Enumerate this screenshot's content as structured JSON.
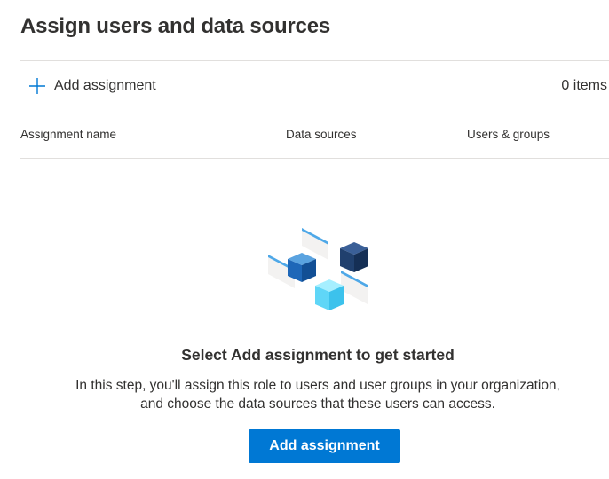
{
  "header": {
    "title": "Assign users and data sources"
  },
  "command_bar": {
    "add_label": "Add assignment",
    "add_icon": "plus-icon",
    "item_count": "0 items"
  },
  "table": {
    "columns": [
      "Assignment name",
      "Data sources",
      "Users & groups"
    ]
  },
  "empty_state": {
    "illustration_icon": "cubes-illustration",
    "title": "Select Add assignment to get started",
    "description_line1": "In this step, you'll assign this role to users and user groups in your organization,",
    "description_line2": "and choose the data sources that these users can access.",
    "button_label": "Add assignment"
  },
  "colors": {
    "accent": "#0078d4",
    "text": "#323130",
    "divider": "#e1dfdd"
  }
}
